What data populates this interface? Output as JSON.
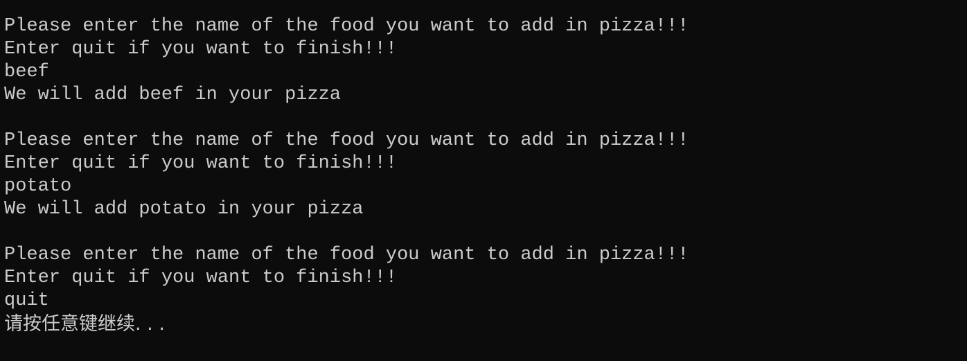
{
  "console": {
    "lines": [
      "Please enter the name of the food you want to add in pizza!!!",
      "Enter quit if you want to finish!!!",
      "beef",
      "We will add beef in your pizza",
      "",
      "Please enter the name of the food you want to add in pizza!!!",
      "Enter quit if you want to finish!!!",
      "potato",
      "We will add potato in your pizza",
      "",
      "Please enter the name of the food you want to add in pizza!!!",
      "Enter quit if you want to finish!!!",
      "quit",
      "请按任意键继续. . ."
    ]
  },
  "colors": {
    "background": "#0c0c0c",
    "text": "#cccccc"
  }
}
